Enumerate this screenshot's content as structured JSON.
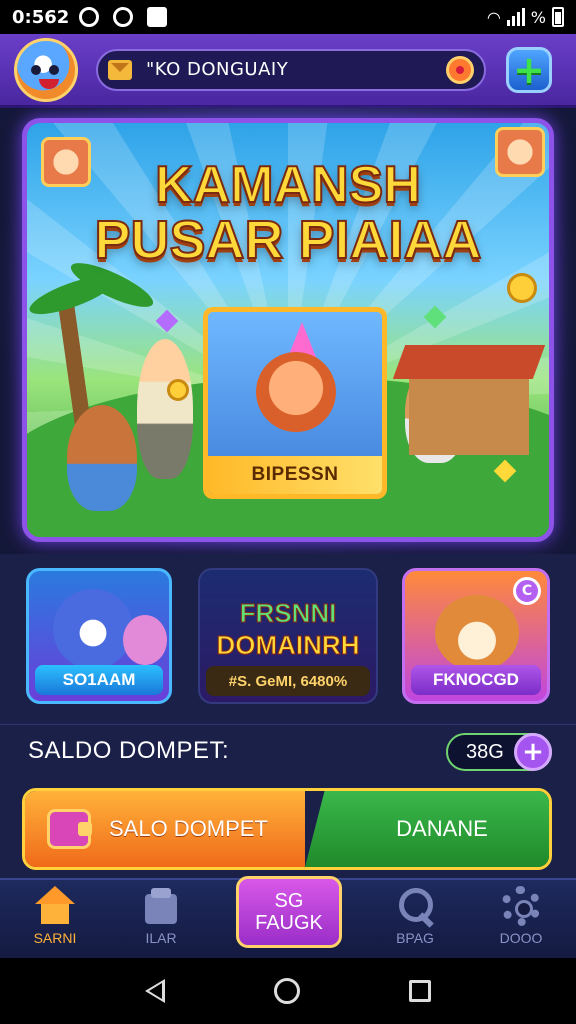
{
  "status_bar": {
    "time": "0:562",
    "battery": "%"
  },
  "header": {
    "search_text": "\"KO DONGUAIY"
  },
  "banner": {
    "title_line1": "KAMANSH",
    "title_line2": "PUSAR PIAIAA",
    "card_caption": "BIPESSN"
  },
  "tiles": [
    {
      "caption": "SO1AAM"
    },
    {
      "title_line1": "FRSNNI",
      "title_line2": "DOMAINRH",
      "caption": "#S. GeMI, 6480%"
    },
    {
      "caption": "FKNOCGD",
      "badge": "C"
    }
  ],
  "saldo": {
    "label": "SALDO DOMPET:",
    "value": "38G",
    "plus": "+"
  },
  "actions": {
    "left_label": "SALO DOMPET",
    "right_label": "DANANE"
  },
  "nav": {
    "home_label": "SARNI",
    "list_label": "ILAR",
    "center_line1": "SG",
    "center_line2": "FAUGK",
    "search_label": "BPAG",
    "settings_label": "DOOO"
  },
  "colors": {
    "accent_purple": "#8d52e8",
    "gold": "#ffd13a",
    "green": "#3ab84a",
    "orange": "#f06a1a"
  }
}
